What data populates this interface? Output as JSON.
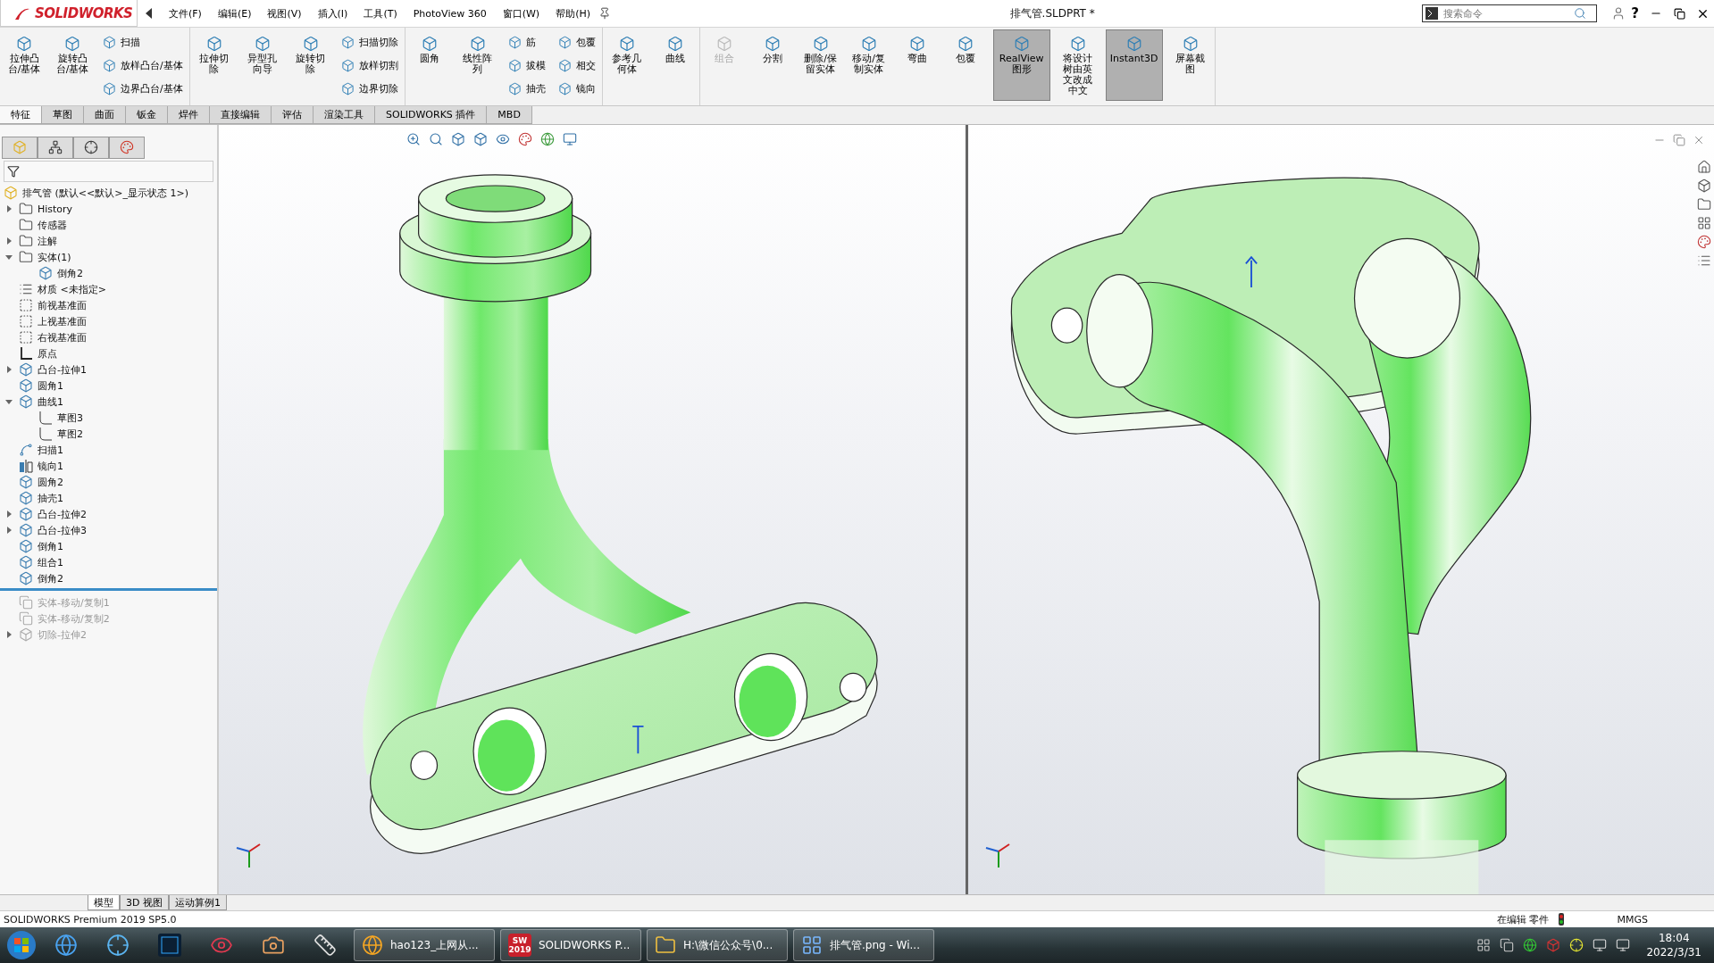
{
  "menu_bar": {
    "logo": "SOLIDWORKS",
    "menus": [
      "文件(F)",
      "编辑(E)",
      "视图(V)",
      "插入(I)",
      "工具(T)",
      "PhotoView 360",
      "窗口(W)",
      "帮助(H)"
    ],
    "title": "排气管.SLDPRT *",
    "search": {
      "placeholder": "搜索命令"
    },
    "help": "?"
  },
  "ribbon": {
    "groups": [
      {
        "items": [
          {
            "kind": "large",
            "label": "拉伸凸台/基体",
            "disabled": false,
            "pressed": false
          },
          {
            "kind": "large",
            "label": "旋转凸台/基体",
            "disabled": false,
            "pressed": false
          },
          {
            "kind": "stack",
            "items": [
              "扫描",
              "放样凸台/基体",
              "边界凸台/基体"
            ]
          }
        ]
      },
      {
        "items": [
          {
            "kind": "large",
            "label": "拉伸切除",
            "disabled": false,
            "pressed": false
          },
          {
            "kind": "large",
            "label": "异型孔向导",
            "disabled": false,
            "pressed": false
          },
          {
            "kind": "large",
            "label": "旋转切除",
            "disabled": false,
            "pressed": false
          },
          {
            "kind": "stack",
            "items": [
              "扫描切除",
              "放样切割",
              "边界切除"
            ]
          }
        ]
      },
      {
        "items": [
          {
            "kind": "large",
            "label": "圆角",
            "disabled": false,
            "pressed": false
          },
          {
            "kind": "large",
            "label": "线性阵列",
            "disabled": false,
            "pressed": false
          },
          {
            "kind": "stack",
            "items": [
              "筋",
              "拔模",
              "抽壳"
            ]
          },
          {
            "kind": "stack",
            "items": [
              "包覆",
              "相交",
              "镜向"
            ]
          }
        ]
      },
      {
        "items": [
          {
            "kind": "large",
            "label": "参考几何体",
            "disabled": false,
            "pressed": false
          },
          {
            "kind": "large",
            "label": "曲线",
            "disabled": false,
            "pressed": false
          }
        ]
      },
      {
        "items": [
          {
            "kind": "large",
            "label": "组合",
            "disabled": true,
            "pressed": false
          },
          {
            "kind": "large",
            "label": "分割",
            "disabled": false,
            "pressed": false
          },
          {
            "kind": "large",
            "label": "删除/保留实体",
            "disabled": false,
            "pressed": false
          },
          {
            "kind": "large",
            "label": "移动/复制实体",
            "disabled": false,
            "pressed": false
          },
          {
            "kind": "large",
            "label": "弯曲",
            "disabled": false,
            "pressed": false
          },
          {
            "kind": "large",
            "label": "包覆",
            "disabled": false,
            "pressed": false
          },
          {
            "kind": "large",
            "label": "RealView图形",
            "disabled": false,
            "pressed": true
          },
          {
            "kind": "large",
            "label": "将设计树由英文改成中文",
            "disabled": false,
            "pressed": false
          },
          {
            "kind": "large",
            "label": "Instant3D",
            "disabled": false,
            "pressed": true
          },
          {
            "kind": "large",
            "label": "屏幕截图",
            "disabled": false,
            "pressed": false
          }
        ]
      }
    ]
  },
  "command_tabs": [
    {
      "label": "特征",
      "selected": true
    },
    {
      "label": "草图",
      "selected": false
    },
    {
      "label": "曲面",
      "selected": false
    },
    {
      "label": "钣金",
      "selected": false
    },
    {
      "label": "焊件",
      "selected": false
    },
    {
      "label": "直接编辑",
      "selected": false
    },
    {
      "label": "评估",
      "selected": false
    },
    {
      "label": "渲染工具",
      "selected": false
    },
    {
      "label": "SOLIDWORKS 插件",
      "selected": false
    },
    {
      "label": "MBD",
      "selected": false
    }
  ],
  "feature_manager": {
    "root": "排气管  (默认<<默认>_显示状态 1>)",
    "items": [
      {
        "kind": "folder",
        "label": "History",
        "expanded": false,
        "rolled_back": false
      },
      {
        "kind": "folder",
        "label": "传感器",
        "rolled_back": false
      },
      {
        "kind": "folder",
        "label": "注解",
        "expanded": false,
        "rolled_back": false
      },
      {
        "kind": "folder",
        "label": "实体(1)",
        "expanded": true,
        "rolled_back": false,
        "children": [
          {
            "kind": "body",
            "label": "倒角2",
            "rolled_back": false
          }
        ]
      },
      {
        "kind": "material",
        "label": "材质 <未指定>",
        "rolled_back": false
      },
      {
        "kind": "plane",
        "label": "前视基准面",
        "rolled_back": false
      },
      {
        "kind": "plane",
        "label": "上视基准面",
        "rolled_back": false
      },
      {
        "kind": "plane",
        "label": "右视基准面",
        "rolled_back": false
      },
      {
        "kind": "origin",
        "label": "原点",
        "rolled_back": false
      },
      {
        "kind": "feature",
        "label": "凸台-拉伸1",
        "expanded": false,
        "rolled_back": false
      },
      {
        "kind": "feature",
        "label": "圆角1",
        "rolled_back": false
      },
      {
        "kind": "feature",
        "label": "曲线1",
        "expanded": true,
        "rolled_back": false,
        "children": [
          {
            "kind": "sketch",
            "label": "草图3",
            "rolled_back": false
          },
          {
            "kind": "sketch",
            "label": "草图2",
            "rolled_back": false
          }
        ]
      },
      {
        "kind": "sweep",
        "label": "扫描1",
        "rolled_back": false
      },
      {
        "kind": "mirror",
        "label": "镜向1",
        "rolled_back": false
      },
      {
        "kind": "feature",
        "label": "圆角2",
        "rolled_back": false
      },
      {
        "kind": "feature",
        "label": "抽壳1",
        "rolled_back": false
      },
      {
        "kind": "feature",
        "label": "凸台-拉伸2",
        "expanded": false,
        "rolled_back": false
      },
      {
        "kind": "feature",
        "label": "凸台-拉伸3",
        "expanded": false,
        "rolled_back": false
      },
      {
        "kind": "feature",
        "label": "倒角1",
        "rolled_back": false
      },
      {
        "kind": "feature",
        "label": "组合1",
        "rolled_back": false
      },
      {
        "kind": "feature",
        "label": "倒角2",
        "rolled_back": false
      },
      {
        "kind": "rollback"
      },
      {
        "kind": "move",
        "label": "实体-移动/复制1",
        "rolled_back": true
      },
      {
        "kind": "move",
        "label": "实体-移动/复制2",
        "rolled_back": true
      },
      {
        "kind": "feature",
        "label": "切除-拉伸2",
        "expanded": false,
        "rolled_back": true
      }
    ]
  },
  "bottom_tabs": [
    {
      "label": "模型",
      "selected": true
    },
    {
      "label": "3D 视图",
      "selected": false
    },
    {
      "label": "运动算例1",
      "selected": false
    }
  ],
  "status_bar": {
    "product": "SOLIDWORKS Premium 2019 SP5.0",
    "mode": "在编辑 零件",
    "units": "MMGS"
  },
  "taskbar": {
    "windows": [
      {
        "kind": "browser",
        "label": "hao123_上网从..."
      },
      {
        "kind": "cad",
        "label": "SOLIDWORKS P...",
        "icon_text": "SW",
        "badge": "2019"
      },
      {
        "kind": "folder",
        "label": "H:\\微信公众号\\0..."
      },
      {
        "kind": "image",
        "label": "排气管.png - Wi..."
      }
    ],
    "time": "18:04",
    "date": "2022/3/31"
  }
}
